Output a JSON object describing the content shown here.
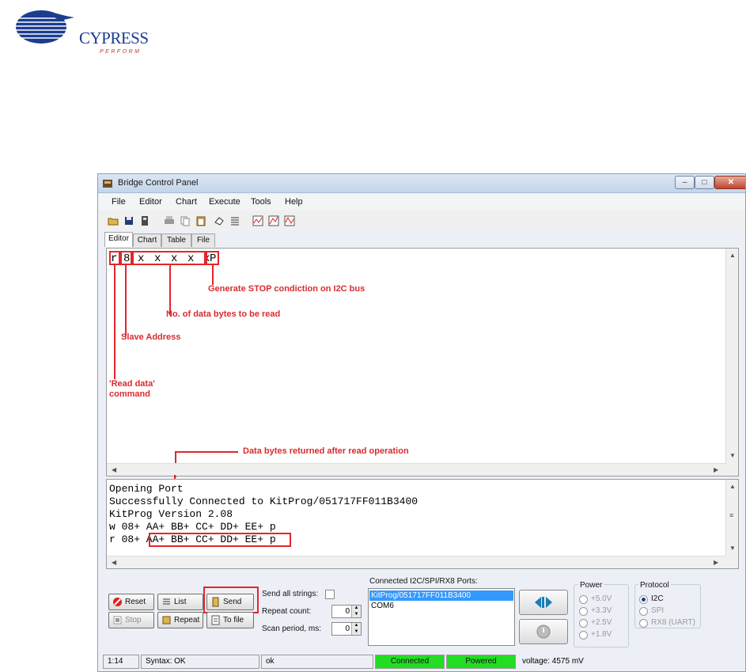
{
  "logo": {
    "brand": "CYPRESS",
    "tagline": "PERFORM"
  },
  "window": {
    "title": "Bridge Control Panel",
    "controls": {
      "minimize": "–",
      "maximize": "□",
      "close": "✕"
    }
  },
  "menu": [
    "File",
    "Editor",
    "Chart",
    "Execute",
    "Tools",
    "Help"
  ],
  "toolbar_icons": [
    "open-icon",
    "save-icon",
    "save-all-icon",
    "print-icon",
    "copy-icon",
    "paste-icon",
    "clear-icon",
    "list-icon",
    "chart-icon",
    "chart-settings-icon",
    "chart-export-icon"
  ],
  "tabs": [
    "Editor",
    "Chart",
    "Table",
    "File"
  ],
  "editor": {
    "command_tokens": [
      "r",
      "8",
      "x",
      "x",
      "x",
      "x",
      "x",
      "P"
    ]
  },
  "annotations": {
    "stop": "Generate STOP condiction on I2C bus",
    "count": "No. of data bytes to be read",
    "address": "Slave Address",
    "read_cmd_1": "'Read data'",
    "read_cmd_2": "command",
    "returned": "Data bytes returned after read operation"
  },
  "log": {
    "lines": [
      "Opening Port",
      "Successfully Connected to KitProg/051717FF011B3400",
      "KitProg Version 2.08",
      "w 08+ AA+ BB+ CC+ DD+ EE+ p",
      "r 08+ AA+ BB+ CC+ DD+ EE+ p"
    ]
  },
  "controls": {
    "reset": "Reset",
    "list": "List",
    "send": "Send",
    "stop": "Stop",
    "repeat": "Repeat",
    "to_file": "To file",
    "send_all_strings": "Send all strings:",
    "repeat_count": "Repeat count:",
    "repeat_count_value": "0",
    "scan_period": "Scan period, ms:",
    "scan_period_value": "0",
    "ports_title": "Connected I2C/SPI/RX8 Ports:",
    "ports": [
      "KitProg/051717FF011B3400",
      "COM6"
    ],
    "power": {
      "title": "Power",
      "options": [
        "+5.0V",
        "+3.3V",
        "+2.5V",
        "+1.8V"
      ]
    },
    "protocol": {
      "title": "Protocol",
      "options": [
        "I2C",
        "SPI",
        "RX8 (UART)"
      ],
      "selected": "I2C"
    }
  },
  "status": {
    "position": "1:14",
    "syntax": "Syntax: OK",
    "message": "ok",
    "connected": "Connected",
    "powered": "Powered",
    "voltage": "voltage: 4575 mV"
  },
  "colors": {
    "annotation": "#e3262b",
    "status_ok": "#22dd22",
    "selection": "#3399ff",
    "brand": "#1a3d8f"
  }
}
